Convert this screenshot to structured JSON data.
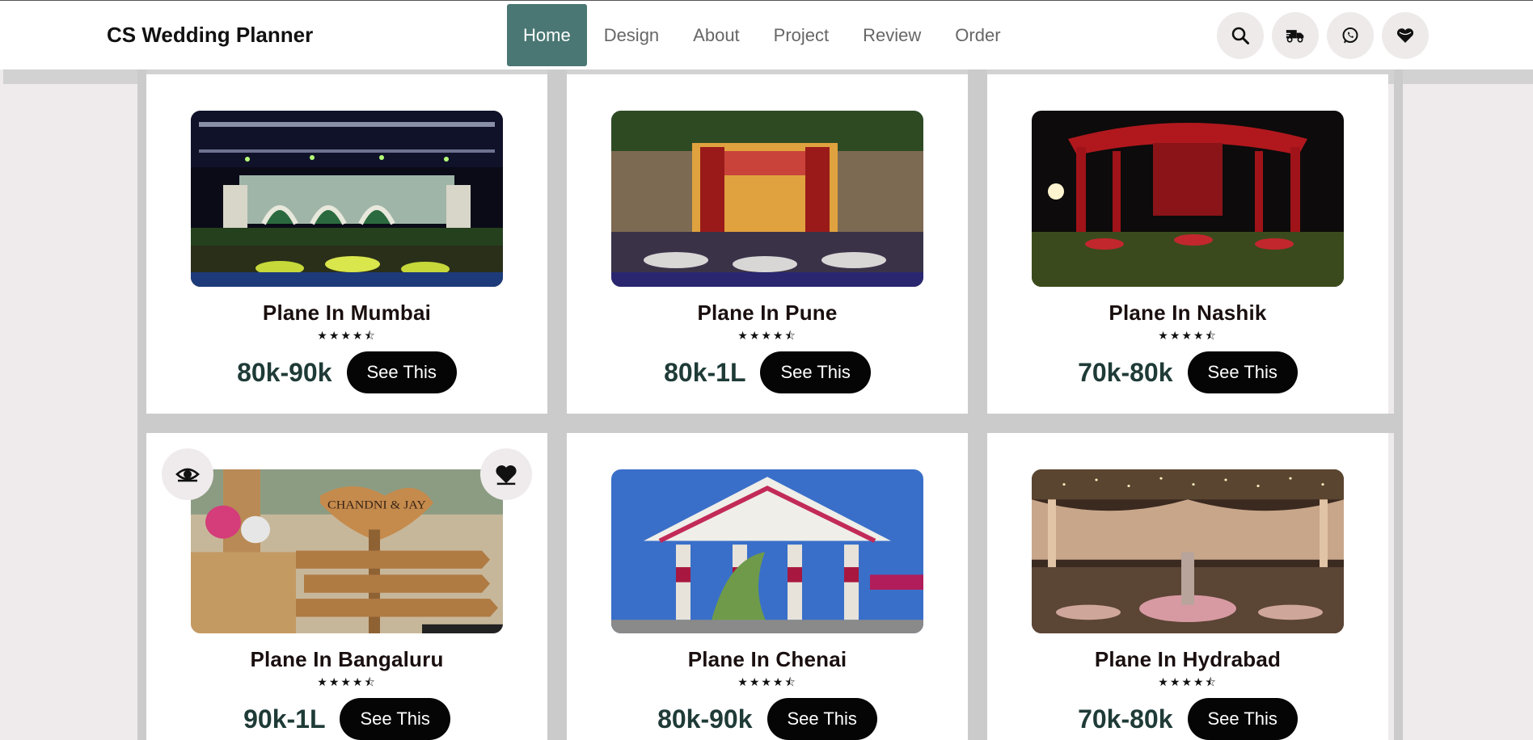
{
  "header": {
    "brand": "CS Wedding Planner",
    "nav": [
      {
        "label": "Home",
        "active": true
      },
      {
        "label": "Design",
        "active": false
      },
      {
        "label": "About",
        "active": false
      },
      {
        "label": "Project",
        "active": false
      },
      {
        "label": "Review",
        "active": false
      },
      {
        "label": "Order",
        "active": false
      }
    ],
    "icons": [
      "search-icon",
      "delivery-truck-icon",
      "whatsapp-icon",
      "heart-icon"
    ]
  },
  "theme": {
    "accent": "#4a7773",
    "price_color": "#1f3b37",
    "button_bg": "#050505",
    "page_bg": "#efebec"
  },
  "cards": [
    {
      "title": "Plane In Mumbai",
      "rating": 4.5,
      "stars": "★★★★⯪",
      "price": "80k-90k",
      "button": "See This",
      "image": "stage-lights-venue"
    },
    {
      "title": "Plane In Pune",
      "rating": 4.5,
      "stars": "★★★★⯪",
      "price": "80k-1L",
      "button": "See This",
      "image": "fort-mandap-dinner"
    },
    {
      "title": "Plane In Nashik",
      "rating": 4.5,
      "stars": "★★★★⯪",
      "price": "70k-80k",
      "button": "See This",
      "image": "red-canopy-lawn"
    },
    {
      "title": "Plane In Bangaluru",
      "rating": 4.5,
      "stars": "★★★★⯪",
      "price": "90k-1L",
      "button": "See This",
      "image": "wooden-welcome-sign"
    },
    {
      "title": "Plane In Chenai",
      "rating": 4.5,
      "stars": "★★★★⯪",
      "price": "80k-90k",
      "button": "See This",
      "image": "floral-mandap"
    },
    {
      "title": "Plane In Hydrabad",
      "rating": 4.5,
      "stars": "★★★★⯪",
      "price": "70k-80k",
      "button": "See This",
      "image": "fairy-light-hall"
    }
  ],
  "card_overlay_icons": [
    "eye-icon",
    "heart-icon"
  ]
}
